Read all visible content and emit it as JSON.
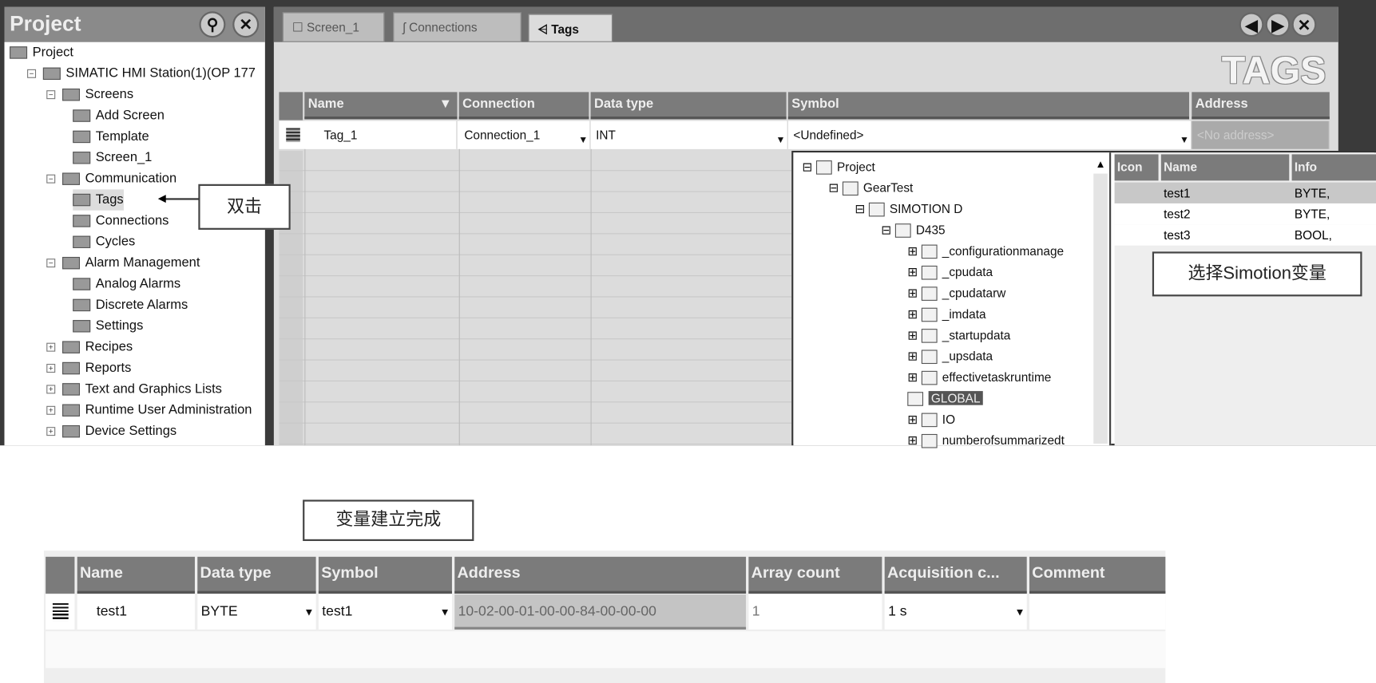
{
  "project_panel": {
    "title": "Project",
    "pin_icon": "pin-icon",
    "close_icon": "close-icon",
    "tree": [
      {
        "label": "Project",
        "level": 0
      },
      {
        "label": "SIMATIC HMI Station(1)(OP 177",
        "level": 1
      },
      {
        "label": "Screens",
        "level": 2
      },
      {
        "label": "Add Screen",
        "level": 3
      },
      {
        "label": "Template",
        "level": 3
      },
      {
        "label": "Screen_1",
        "level": 3
      },
      {
        "label": "Communication",
        "level": 2
      },
      {
        "label": "Tags",
        "level": 3
      },
      {
        "label": "Connections",
        "level": 3
      },
      {
        "label": "Cycles",
        "level": 3
      },
      {
        "label": "Alarm Management",
        "level": 2
      },
      {
        "label": "Analog Alarms",
        "level": 3
      },
      {
        "label": "Discrete Alarms",
        "level": 3
      },
      {
        "label": "Settings",
        "level": 3
      },
      {
        "label": "Recipes",
        "level": 2
      },
      {
        "label": "Reports",
        "level": 2
      },
      {
        "label": "Text and Graphics Lists",
        "level": 2
      },
      {
        "label": "Runtime User Administration",
        "level": 2
      },
      {
        "label": "Device Settings",
        "level": 2
      }
    ]
  },
  "tabs": [
    {
      "label": "Screen_1"
    },
    {
      "label": "Connections"
    },
    {
      "label": "Tags"
    }
  ],
  "editor_title": "TAGS",
  "tags_table": {
    "columns": [
      "Name",
      "Connection",
      "Data type",
      "Symbol",
      "Address"
    ],
    "row": {
      "name": "Tag_1",
      "connection": "Connection_1",
      "data_type": "INT",
      "symbol": "<Undefined>",
      "address": "<No address>"
    }
  },
  "symbol_popup": {
    "tree": [
      {
        "label": "Project",
        "level": 0
      },
      {
        "label": "GearTest",
        "level": 1
      },
      {
        "label": "SIMOTION D",
        "level": 2
      },
      {
        "label": "D435",
        "level": 3
      },
      {
        "label": "_configurationmanage",
        "level": 4
      },
      {
        "label": "_cpudata",
        "level": 4
      },
      {
        "label": "_cpudatarw",
        "level": 4
      },
      {
        "label": "_imdata",
        "level": 4
      },
      {
        "label": "_startupdata",
        "level": 4
      },
      {
        "label": "_upsdata",
        "level": 4
      },
      {
        "label": "effectivetaskruntime",
        "level": 4
      },
      {
        "label": "GLOBAL",
        "level": 4,
        "selected": true
      },
      {
        "label": "IO",
        "level": 4
      },
      {
        "label": "numberofsummarizedt",
        "level": 4
      }
    ],
    "list_columns": [
      "Icon",
      "Name",
      "Info"
    ],
    "list_rows": [
      {
        "name": "test1",
        "info": "BYTE,"
      },
      {
        "name": "test2",
        "info": "BYTE,"
      },
      {
        "name": "test3",
        "info": "BOOL,"
      }
    ]
  },
  "callouts": {
    "double_click": "双击",
    "select_var": "选择Simotion变量",
    "done": "变量建立完成"
  },
  "result_table": {
    "columns": [
      "Name",
      "Data type",
      "Symbol",
      "Address",
      "Array count",
      "Acquisition c...",
      "Comment"
    ],
    "row": {
      "name": "test1",
      "data_type": "BYTE",
      "symbol": "test1",
      "address": "10-02-00-01-00-00-84-00-00-00",
      "array_count": "1",
      "acquisition": "1 s",
      "comment": ""
    }
  }
}
